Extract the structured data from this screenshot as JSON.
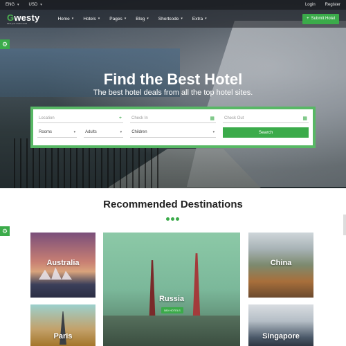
{
  "topbar": {
    "language": "ENG",
    "currency": "USD",
    "login": "Login",
    "register": "Register"
  },
  "nav": {
    "logo_first": "G",
    "logo_rest": "westy",
    "logo_tagline": "Find your dream hotel",
    "menu": [
      {
        "label": "Home"
      },
      {
        "label": "Hotels"
      },
      {
        "label": "Pages"
      },
      {
        "label": "Blog"
      },
      {
        "label": "Shortcode"
      },
      {
        "label": "Extra"
      }
    ],
    "submit_label": "Submit Hotel"
  },
  "hero": {
    "title": "Find the Best Hotel",
    "subtitle": "The best hotel deals from all the top hotel sites."
  },
  "search": {
    "location_placeholder": "Location",
    "checkin_placeholder": "Check In",
    "checkout_placeholder": "Check Out",
    "rooms": "Rooms",
    "adults": "Adults",
    "children": "Children",
    "search_label": "Search"
  },
  "section": {
    "title": "Recommended Destinations"
  },
  "destinations": {
    "australia": "Australia",
    "russia": "Russia",
    "russia_badge": "580 HOTELS",
    "china": "China",
    "paris": "Paris",
    "singapore": "Singapore"
  },
  "colors": {
    "accent": "#3bab4a"
  }
}
